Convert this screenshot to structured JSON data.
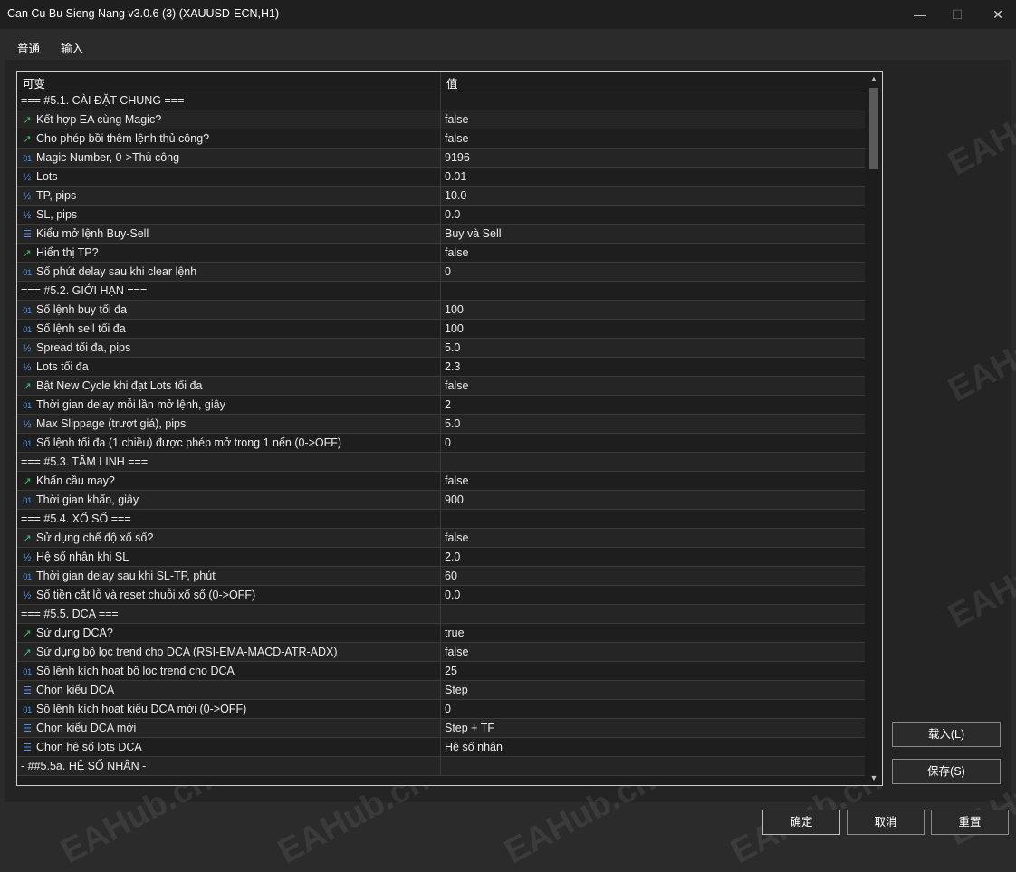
{
  "window": {
    "title": "Can Cu Bu Sieng Nang v3.0.6 (3) (XAUUSD-ECN,H1)",
    "minimize_glyph": "—",
    "maximize_glyph": "☐",
    "close_glyph": "✕"
  },
  "tabs": [
    {
      "label": "普通",
      "active": false
    },
    {
      "label": "输入",
      "active": true
    }
  ],
  "grid": {
    "header": {
      "name": "可变",
      "value": "值"
    },
    "rows": [
      {
        "type": "section",
        "name": "=== #5.1. CÀI ĐẶT CHUNG ===",
        "value": ""
      },
      {
        "type": "bool",
        "name": "Kết hợp EA cùng Magic?",
        "value": "false"
      },
      {
        "type": "bool",
        "name": "Cho phép bồi thêm lệnh thủ công?",
        "value": "false"
      },
      {
        "type": "int",
        "name": "Magic Number, 0->Thủ công",
        "value": "9196"
      },
      {
        "type": "double",
        "name": "Lots",
        "value": "0.01"
      },
      {
        "type": "double",
        "name": "TP, pips",
        "value": "10.0"
      },
      {
        "type": "double",
        "name": "SL, pips",
        "value": "0.0"
      },
      {
        "type": "enum",
        "name": "Kiểu mở lệnh Buy-Sell",
        "value": "Buy và Sell"
      },
      {
        "type": "bool",
        "name": "Hiển thị TP?",
        "value": "false"
      },
      {
        "type": "int",
        "name": "Số phút delay sau khi clear lệnh",
        "value": "0"
      },
      {
        "type": "section",
        "name": "=== #5.2. GIỚI HẠN ===",
        "value": ""
      },
      {
        "type": "int",
        "name": "Số lệnh buy tối đa",
        "value": "100"
      },
      {
        "type": "int",
        "name": "Số lệnh sell tối đa",
        "value": "100"
      },
      {
        "type": "double",
        "name": "Spread tối đa, pips",
        "value": "5.0"
      },
      {
        "type": "double",
        "name": "Lots tối đa",
        "value": "2.3"
      },
      {
        "type": "bool",
        "name": "Bật New Cycle khi đạt Lots tối đa",
        "value": "false"
      },
      {
        "type": "int",
        "name": "Thời gian delay mỗi lần mở lệnh, giây",
        "value": "2"
      },
      {
        "type": "double",
        "name": "Max Slippage (trượt giá), pips",
        "value": "5.0"
      },
      {
        "type": "int",
        "name": "Số lệnh tối đa (1 chiều) được phép mở trong 1 nến (0->OFF)",
        "value": "0"
      },
      {
        "type": "section",
        "name": "=== #5.3. TÂM LINH ===",
        "value": ""
      },
      {
        "type": "bool",
        "name": "Khấn cầu may?",
        "value": "false"
      },
      {
        "type": "int",
        "name": "Thời gian khấn, giây",
        "value": "900"
      },
      {
        "type": "section",
        "name": "=== #5.4. XỔ SỐ ===",
        "value": ""
      },
      {
        "type": "bool",
        "name": "Sử dụng chế độ xổ số?",
        "value": "false"
      },
      {
        "type": "double",
        "name": "Hệ số nhân khi SL",
        "value": "2.0"
      },
      {
        "type": "int",
        "name": "Thời gian delay sau khi SL-TP, phút",
        "value": "60"
      },
      {
        "type": "double",
        "name": "Số tiền cắt lỗ và reset chuỗi xổ số (0->OFF)",
        "value": "0.0"
      },
      {
        "type": "section",
        "name": "=== #5.5. DCA ===",
        "value": ""
      },
      {
        "type": "bool",
        "name": "Sử dụng DCA?",
        "value": "true"
      },
      {
        "type": "bool",
        "name": "Sử dụng bộ lọc trend cho DCA (RSI-EMA-MACD-ATR-ADX)",
        "value": "false"
      },
      {
        "type": "int",
        "name": "Số lệnh kích hoạt bộ lọc trend cho DCA",
        "value": "25"
      },
      {
        "type": "enum",
        "name": "Chọn kiểu DCA",
        "value": "Step"
      },
      {
        "type": "int",
        "name": "Số lệnh kích hoạt kiểu DCA mới (0->OFF)",
        "value": "0"
      },
      {
        "type": "enum",
        "name": "Chọn kiểu DCA mới",
        "value": "Step + TF"
      },
      {
        "type": "enum",
        "name": "Chọn hệ số lots DCA",
        "value": "Hệ số nhân"
      },
      {
        "type": "section",
        "name": "- ##5.5a. HỆ SỐ NHÂN -",
        "value": ""
      }
    ]
  },
  "icons": {
    "bool": "↗",
    "int": "01",
    "double": "½",
    "enum": "☰"
  },
  "side_buttons": {
    "load": "载入(L)",
    "save": "保存(S)"
  },
  "footer_buttons": {
    "ok": "确定",
    "cancel": "取消",
    "reset": "重置"
  },
  "watermark": "EAHub.cn",
  "colors": {
    "accent": "#2f8ce6",
    "bool_icon": "#3fbf6f",
    "num_icon": "#4a8ee8"
  }
}
